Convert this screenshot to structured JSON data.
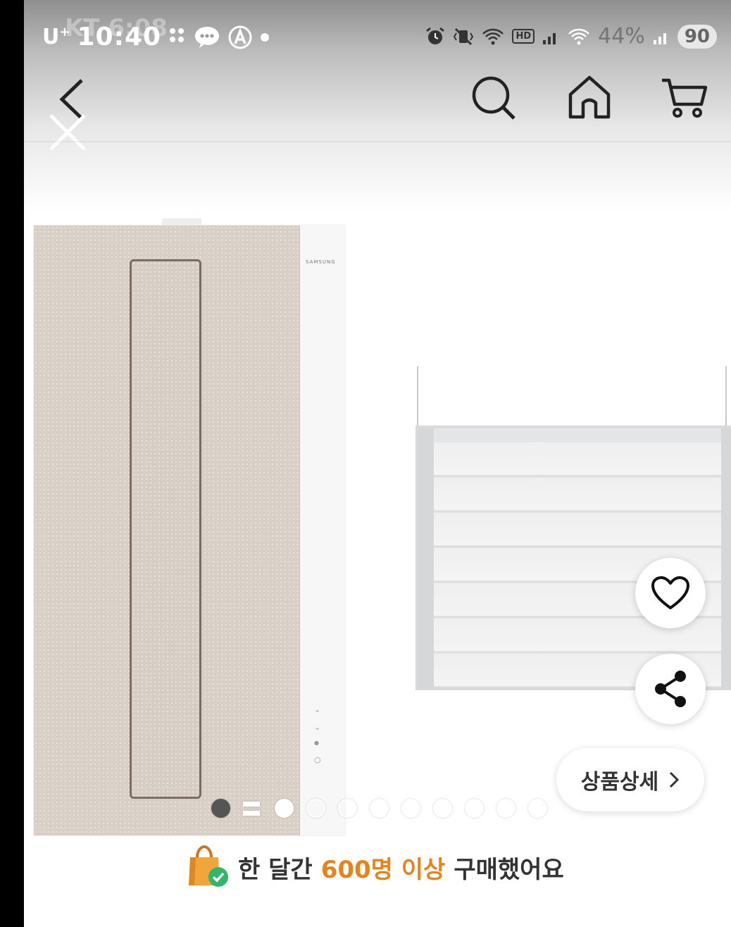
{
  "status_bar": {
    "carrier": "U",
    "carrier_sup": "+",
    "time": "10:40",
    "ghost_time": "KT 6:08",
    "battery": "90",
    "ghost_battery": "44%"
  },
  "header": {
    "back_icon": "chevron-left-icon",
    "close_icon": "close-icon",
    "search_icon": "search-icon",
    "home_icon": "home-icon",
    "cart_icon": "cart-icon"
  },
  "product": {
    "brand": "SAMSUNG",
    "details_button": "상품상세",
    "pager": {
      "total": 11,
      "current": 1
    }
  },
  "banner": {
    "prefix": "한 달간",
    "highlight": "600명 이상",
    "suffix": "구매했어요"
  },
  "colors": {
    "accent": "#e8831c",
    "check_green": "#2fb86a",
    "bag_orange": "#f2a53a"
  }
}
